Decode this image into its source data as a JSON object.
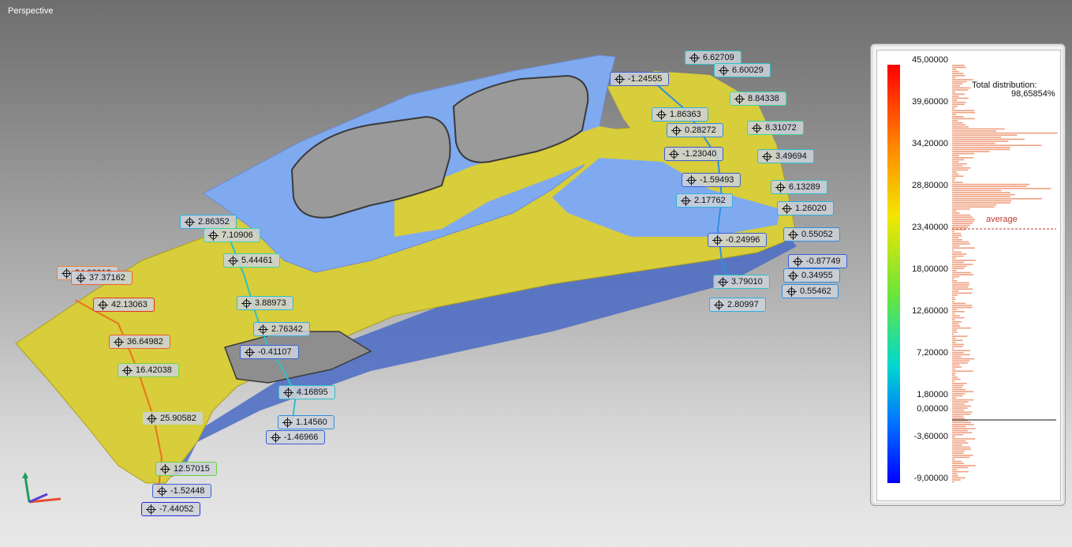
{
  "view": {
    "title": "Perspective"
  },
  "legend": {
    "ticks": [
      "45,00000",
      "39,60000",
      "34,20000",
      "28,80000",
      "23,40000",
      "18,00000",
      "12,60000",
      "7,20000",
      "1,80000",
      "0,00000",
      "-3,60000",
      "-9,00000"
    ],
    "distribution_label": "Total distribution:",
    "distribution_value": "98,65854%",
    "average_label": "average",
    "histogram_color": "#f0a080",
    "average_color": "#c0392b"
  },
  "colors": {
    "blue_surface": "#80aaf0",
    "yellow_surface": "#d8cd3a"
  },
  "points": [
    {
      "label": "6.62709",
      "color": "#2fc0c8"
    },
    {
      "label": "6.60029",
      "color": "#2fc0c8"
    },
    {
      "label": "-1.24555",
      "color": "#3b5fd6"
    },
    {
      "label": "8.84338",
      "color": "#3ed79a"
    },
    {
      "label": "1.86363",
      "color": "#2fb0e0"
    },
    {
      "label": "0.28272",
      "color": "#2f8fe0"
    },
    {
      "label": "8.31072",
      "color": "#3ed79a"
    },
    {
      "label": "-1.23040",
      "color": "#3b5fd6"
    },
    {
      "label": "3.49694",
      "color": "#2fc0c8"
    },
    {
      "label": "-1.59493",
      "color": "#3b5fd6"
    },
    {
      "label": "6.13289",
      "color": "#2fc0c8"
    },
    {
      "label": "2.17762",
      "color": "#2fb0e0"
    },
    {
      "label": "1.26020",
      "color": "#2fb0e0"
    },
    {
      "label": "0.55052",
      "color": "#2f8fe0"
    },
    {
      "label": "-0.24996",
      "color": "#3b5fd6"
    },
    {
      "label": "-0.87749",
      "color": "#3b5fd6"
    },
    {
      "label": "0.34955",
      "color": "#2f8fe0"
    },
    {
      "label": "3.79010",
      "color": "#2fc0c8"
    },
    {
      "label": "0.55462",
      "color": "#2f8fe0"
    },
    {
      "label": "2.80997",
      "color": "#2fb0e0"
    },
    {
      "label": "2.86352",
      "color": "#2fb0e0"
    },
    {
      "label": "7.10906",
      "color": "#3ed79a"
    },
    {
      "label": "5.44461",
      "color": "#3ed79a"
    },
    {
      "label": "34.99913",
      "color": "#f08030"
    },
    {
      "label": "37.37162",
      "color": "#f06030"
    },
    {
      "label": "42.13063",
      "color": "#e8331f"
    },
    {
      "label": "3.88973",
      "color": "#2fc0c8"
    },
    {
      "label": "2.76342",
      "color": "#2fb0e0"
    },
    {
      "label": "-0.41107",
      "color": "#3b5fd6"
    },
    {
      "label": "36.64982",
      "color": "#f06030"
    },
    {
      "label": "16.42038",
      "color": "#7bd43a"
    },
    {
      "label": "4.16895",
      "color": "#2fc0c8"
    },
    {
      "label": "25.90582",
      "color": "#c8d63a"
    },
    {
      "label": "1.14560",
      "color": "#2f8fe0"
    },
    {
      "label": "-1.46966",
      "color": "#3b5fd6"
    },
    {
      "label": "12.57015",
      "color": "#6ad23a"
    },
    {
      "label": "-1.52448",
      "color": "#3b5fd6"
    },
    {
      "label": "-7.44052",
      "color": "#2b2bd8"
    }
  ]
}
